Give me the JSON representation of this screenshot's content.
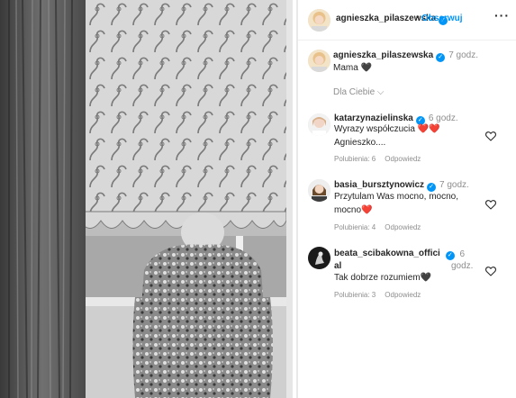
{
  "post": {
    "author": "agnieszka_pilaszewska",
    "follow_label": "Obserwuj",
    "more_label": "···",
    "separator": "•",
    "caption_author": "agnieszka_pilaszewska",
    "caption_time": "7 godz.",
    "caption_text": "Mama 🖤",
    "for_you_label": "Dla Ciebie ⌵"
  },
  "comments": [
    {
      "author": "katarzynazielinska",
      "time": "6 godz.",
      "text_line1": "Wyrazy współczucia ❤️❤️",
      "text_line2": "Agnieszko....",
      "likes": "Polubienia: 6",
      "reply": "Odpowiedz"
    },
    {
      "author": "basia_bursztynowicz",
      "time": "7 godz.",
      "text_line1": "Przytulam Was mocno, mocno,",
      "text_line2": "mocno❤️",
      "likes": "Polubienia: 4",
      "reply": "Odpowiedz"
    },
    {
      "author_line1": "beata_scibakowna_offici",
      "author_line2": "al",
      "time_line1": "6",
      "time_line2": "godz.",
      "text_line1": "Tak dobrze rozumiem🖤",
      "likes": "Polubienia: 3",
      "reply": "Odpowiedz"
    }
  ],
  "colors": {
    "accent": "#0095f6",
    "secondary_text": "#8e8e8e",
    "primary_text": "#262626"
  },
  "icons": [
    "verified-badge-icon",
    "heart-outline-icon",
    "more-options-icon",
    "chevron-down-icon"
  ]
}
